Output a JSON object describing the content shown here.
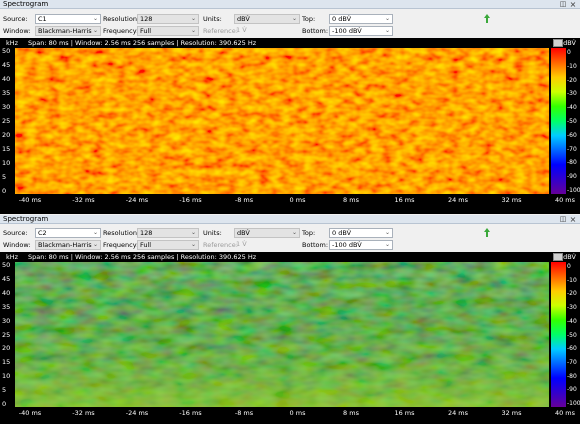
{
  "panels": [
    {
      "title": "Spectrogram",
      "source_label": "Source:",
      "source_value": "C1",
      "resolution_label": "Resolution:",
      "resolution_value": "128",
      "units_label": "Units:",
      "units_value": "dBV̂",
      "top_label": "Top:",
      "top_value": "0 dBV̂",
      "window_label": "Window:",
      "window_value": "Blackman-Harris",
      "frequency_label": "Frequency:",
      "frequency_value": "Full",
      "reference_label": "Reference:",
      "reference_value": "1 V̂",
      "bottom_label": "Bottom:",
      "bottom_value": "-100 dBV̂",
      "freq_unit": "kHz",
      "info": "Span: 80 ms | Window: 2.56 ms 256 samples | Resolution: 390.625 Hz",
      "level_unit": "dBV̂",
      "y_ticks": [
        "50",
        "45",
        "40",
        "35",
        "30",
        "25",
        "20",
        "15",
        "10",
        "5",
        "0"
      ],
      "x_ticks": [
        "-40 ms",
        "-32 ms",
        "-24 ms",
        "-16 ms",
        "-8 ms",
        "0 ms",
        "8 ms",
        "16 ms",
        "24 ms",
        "32 ms",
        "40 ms"
      ],
      "color_ticks": [
        "0",
        "-10",
        "-20",
        "-30",
        "-40",
        "-50",
        "-60",
        "-70",
        "-80",
        "-90",
        "-100"
      ],
      "dominant_color": "#ff5a00"
    },
    {
      "title": "Spectrogram",
      "source_label": "Source:",
      "source_value": "C2",
      "resolution_label": "Resolution:",
      "resolution_value": "128",
      "units_label": "Units:",
      "units_value": "dBV̂",
      "top_label": "Top:",
      "top_value": "0 dBV̂",
      "window_label": "Window:",
      "window_value": "Blackman-Harris",
      "frequency_label": "Frequency:",
      "frequency_value": "Full",
      "reference_label": "Reference:",
      "reference_value": "1 V̂",
      "bottom_label": "Bottom:",
      "bottom_value": "-100 dBV̂",
      "freq_unit": "kHz",
      "info": "Span: 80 ms | Window: 2.56 ms 256 samples | Resolution: 390.625 Hz",
      "level_unit": "dBV̂",
      "y_ticks": [
        "50",
        "45",
        "40",
        "35",
        "30",
        "25",
        "20",
        "15",
        "10",
        "5",
        "0"
      ],
      "x_ticks": [
        "-40 ms",
        "-32 ms",
        "-24 ms",
        "-16 ms",
        "-8 ms",
        "0 ms",
        "8 ms",
        "16 ms",
        "24 ms",
        "32 ms",
        "40 ms"
      ],
      "color_ticks": [
        "0",
        "-10",
        "-20",
        "-30",
        "-40",
        "-50",
        "-60",
        "-70",
        "-80",
        "-90",
        "-100"
      ],
      "dominant_color": "#3f9e2a"
    }
  ],
  "colors": {
    "arrow": "#3aa83a",
    "scale": [
      "#ff0000",
      "#ff6600",
      "#ffcc00",
      "#ccff00",
      "#33ff00",
      "#00ff66",
      "#00ccff",
      "#0066ff",
      "#0000ff",
      "#3300cc",
      "#660099"
    ]
  }
}
